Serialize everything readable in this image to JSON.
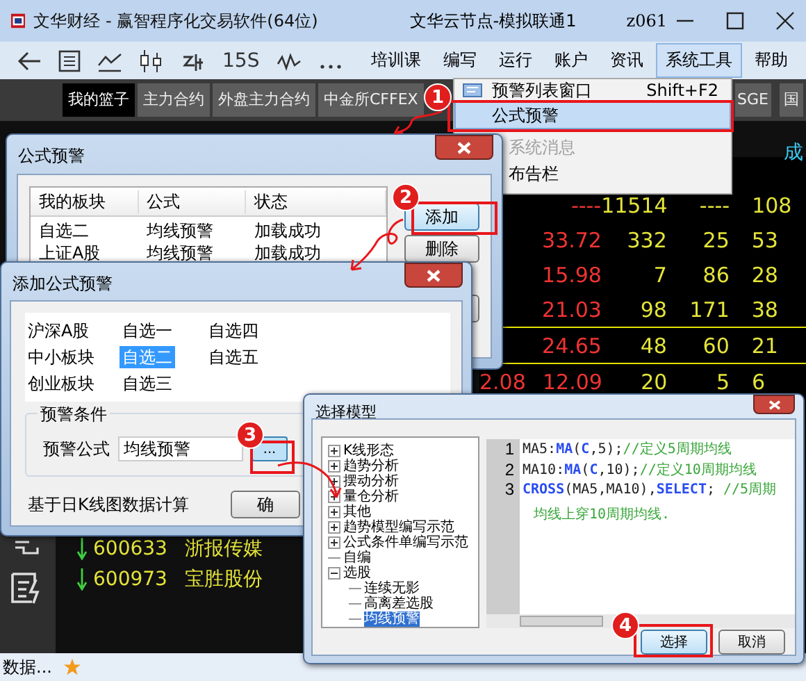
{
  "window": {
    "title": "文华财经  -  赢智程序化交易软件(64位)",
    "server": "文华云节点-模拟联通1",
    "user": "z061"
  },
  "toolbar": {
    "interval": "15S"
  },
  "menu": [
    {
      "label": "培训课",
      "selected": false
    },
    {
      "label": "编写",
      "selected": false
    },
    {
      "label": "运行",
      "selected": false
    },
    {
      "label": "账户",
      "selected": false
    },
    {
      "label": "资讯",
      "selected": false
    },
    {
      "label": "系统工具",
      "selected": true
    },
    {
      "label": "帮助",
      "selected": false
    }
  ],
  "tabs": [
    {
      "label": "我的篮子",
      "selected": true
    },
    {
      "label": "主力合约",
      "selected": false
    },
    {
      "label": "外盘主力合约",
      "selected": false
    },
    {
      "label": "中金所CFFEX",
      "selected": false
    },
    {
      "label": "SGE",
      "selected": false
    },
    {
      "label": "国",
      "selected": false
    }
  ],
  "dropdown": [
    {
      "label": "预警列表窗口",
      "shortcut": "Shift+F2",
      "highlighted": false,
      "disabled": false
    },
    {
      "label": "公式预警",
      "highlighted": true,
      "disabled": false
    },
    {
      "label": "系统消息",
      "highlighted": false,
      "disabled": true
    },
    {
      "label": "布告栏",
      "highlighted": false,
      "disabled": false
    }
  ],
  "quotes": {
    "header": "成",
    "rows": [
      {
        "lead": "",
        "cells": [
          "----",
          "11514",
          "----",
          "108"
        ]
      },
      {
        "lead": "",
        "cells": [
          "33.72",
          "332",
          "25",
          "53"
        ]
      },
      {
        "lead": "",
        "cells": [
          "15.98",
          "7",
          "86",
          "28"
        ]
      },
      {
        "lead": "",
        "cells": [
          "21.03",
          "98",
          "171",
          "38"
        ]
      },
      {
        "lead": "",
        "cells": [
          "24.65",
          "48",
          "60",
          "21"
        ]
      },
      {
        "lead": "2.08",
        "cells": [
          "12.09",
          "20",
          "5",
          "6"
        ]
      }
    ]
  },
  "stock_list": [
    {
      "code": "600633",
      "name": "浙报传媒",
      "falling": true
    },
    {
      "code": "600973",
      "name": "宝胜股份",
      "falling": true
    }
  ],
  "status_bar": {
    "text": "数据..."
  },
  "alert_dialog": {
    "title": "公式预警",
    "columns": [
      "我的板块",
      "公式",
      "状态"
    ],
    "rows": [
      [
        "自选二",
        "均线预警",
        "加载成功"
      ],
      [
        "上证A股",
        "均线预警",
        "加载成功"
      ]
    ],
    "buttons": [
      {
        "label": "添加",
        "focused": true
      },
      {
        "label": "删除",
        "focused": false
      }
    ]
  },
  "add_dialog": {
    "title": "添加公式预警",
    "blocks": [
      {
        "label": "沪深A股",
        "selected": false
      },
      {
        "label": "自选一",
        "selected": false
      },
      {
        "label": "自选四",
        "selected": false
      },
      {
        "label": "中小板块",
        "selected": false
      },
      {
        "label": "自选二",
        "selected": true
      },
      {
        "label": "自选五",
        "selected": false
      },
      {
        "label": "创业板块",
        "selected": false
      },
      {
        "label": "自选三",
        "selected": false
      }
    ],
    "group": "预警条件",
    "formula_label": "预警公式",
    "formula_value": "均线预警",
    "browse_button": "...",
    "note": "基于日K线图数据计算",
    "ok_button": "确"
  },
  "model_dialog": {
    "title": "选择模型",
    "tree": [
      {
        "label": "K线形态",
        "kind": "folder",
        "expanded": false,
        "selected": false
      },
      {
        "label": "趋势分析",
        "kind": "folder",
        "expanded": false,
        "selected": false
      },
      {
        "label": "摆动分析",
        "kind": "folder",
        "expanded": false,
        "selected": false
      },
      {
        "label": "量仓分析",
        "kind": "folder",
        "expanded": false,
        "selected": false
      },
      {
        "label": "其他",
        "kind": "folder",
        "expanded": false,
        "selected": false
      },
      {
        "label": "趋势模型编写示范",
        "kind": "folder",
        "expanded": false,
        "selected": false
      },
      {
        "label": "公式条件单编写示范",
        "kind": "folder",
        "expanded": false,
        "selected": false
      },
      {
        "label": "自编",
        "kind": "leaf",
        "selected": false
      },
      {
        "label": "选股",
        "kind": "folder",
        "expanded": true,
        "selected": false,
        "children": [
          {
            "label": "连续无影",
            "kind": "leaf",
            "selected": false
          },
          {
            "label": "高离差选股",
            "kind": "leaf",
            "selected": false
          },
          {
            "label": "均线预警",
            "kind": "leaf",
            "selected": true
          }
        ]
      }
    ],
    "code": [
      {
        "number": "1",
        "segments": [
          {
            "text": "MA5:",
            "kind": "plain"
          },
          {
            "text": "MA",
            "kind": "func"
          },
          {
            "text": "(",
            "kind": "plain"
          },
          {
            "text": "C",
            "kind": "func"
          },
          {
            "text": ",5);",
            "kind": "plain"
          },
          {
            "text": "//定义5周期均线",
            "kind": "comment"
          }
        ]
      },
      {
        "number": "2",
        "segments": [
          {
            "text": "MA10:",
            "kind": "plain"
          },
          {
            "text": "MA",
            "kind": "func"
          },
          {
            "text": "(",
            "kind": "plain"
          },
          {
            "text": "C",
            "kind": "func"
          },
          {
            "text": ",10);",
            "kind": "plain"
          },
          {
            "text": "//定义10周期均线",
            "kind": "comment"
          }
        ]
      },
      {
        "number": "3",
        "segments": [
          {
            "text": "CROSS",
            "kind": "func"
          },
          {
            "text": "(MA5,MA10),",
            "kind": "plain"
          },
          {
            "text": "SELECT",
            "kind": "func"
          },
          {
            "text": "; ",
            "kind": "plain"
          },
          {
            "text": "//5周期",
            "kind": "comment"
          }
        ]
      },
      {
        "segments": [
          {
            "text": "均线上穿10周期均线.",
            "kind": "comment"
          }
        ]
      }
    ],
    "buttons": [
      {
        "label": "选择",
        "focused": true
      },
      {
        "label": "取消",
        "focused": false
      }
    ]
  },
  "steps": [
    "1",
    "2",
    "3",
    "4"
  ]
}
